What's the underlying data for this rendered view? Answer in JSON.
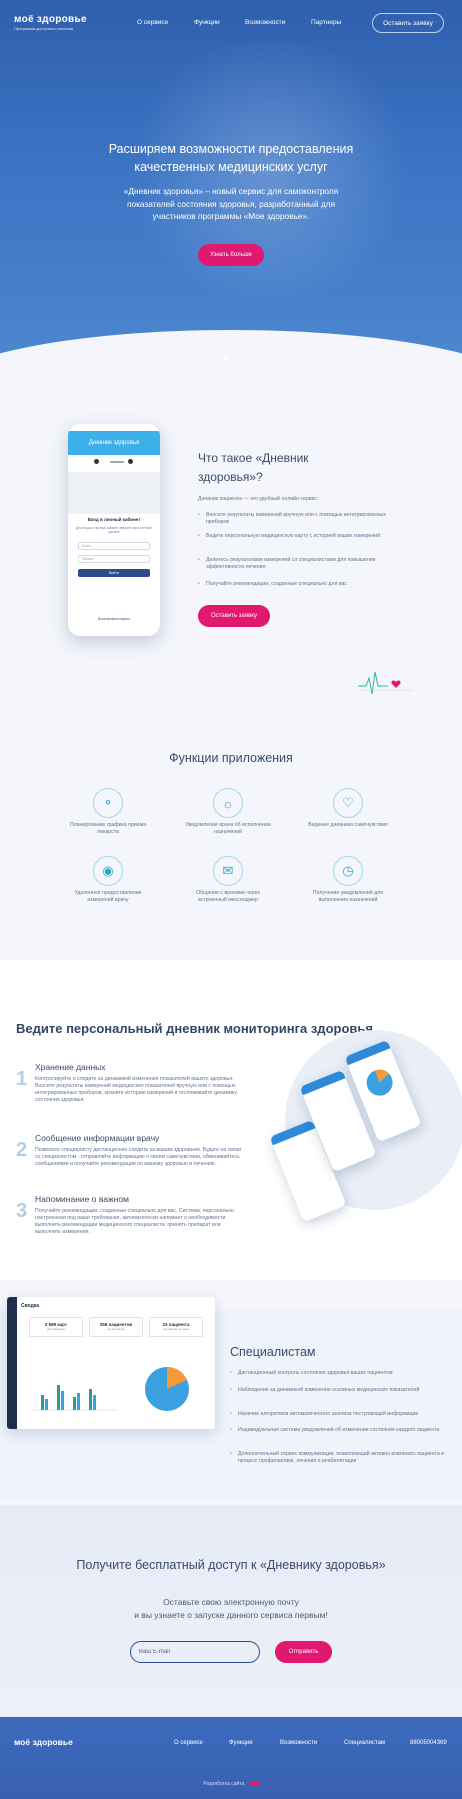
{
  "header": {
    "logo": "моё здоровье",
    "logo_sub": "Программа доступного лечения",
    "nav": [
      "О сервисе",
      "Функции",
      "Возможности",
      "Партнеры"
    ],
    "cta": "Оставить заявку"
  },
  "hero": {
    "title": "Расширяем возможности предоставления качественных медицинских услуг",
    "text": "«Дневник здоровья» – новый сервис для самоконтроля показателей состояния здоровья, разработанный для участников программы «Мое здоровье».",
    "button": "Узнать больше"
  },
  "phone": {
    "app_title": "Дневник здоровья",
    "login_title": "Вход в личный кабинет",
    "login_sub": "Для входа в личный кабинет введите свои учетные данные",
    "login_placeholder": "Логин",
    "password_placeholder": "Пароль",
    "login_button": "Войти",
    "forgot": "Восстановить пароль"
  },
  "about": {
    "title": "Что такое «Дневник здоровья»?",
    "intro": "Дневник пациента — это удобный онлайн сервис:",
    "items": [
      "Вносите результаты измерений вручную или с помощью интегрированных приборов",
      "Ведите персональную медицинскую карту с историей ваших измерений",
      "Делитесь результатами измерений со специалистами для повышения эффективности лечения",
      "Получайте рекомендации, созданные специально для вас"
    ],
    "button": "Оставить заявку"
  },
  "functions": {
    "title": "Функции приложения",
    "items": [
      {
        "label": "Планирование графика приема лекарств",
        "icon": "pill-icon"
      },
      {
        "label": "Уведомление врача об исполнении назначений",
        "icon": "bell-icon"
      },
      {
        "label": "Ведение дневника самочувствия",
        "icon": "heart-icon"
      },
      {
        "label": "Удаленное предоставление измерений врачу",
        "icon": "lock-icon"
      },
      {
        "label": "Общение с врачами через встроенный мессенджер",
        "icon": "message-icon"
      },
      {
        "label": "Получение уведомлений для выполнения назначений",
        "icon": "alarm-icon"
      }
    ]
  },
  "diary": {
    "title": "Ведите персональный дневник мониторинга здоровья",
    "items": [
      {
        "num": "1",
        "title": "Хранение данных",
        "text": "Контролируйте и следите за динамикой изменения показателей вашего здоровья. Вносите результаты измерений медицинских показателей вручную или с помощью интегрированных приборов, храните историю измерений и отслеживайте динамику состояния здоровья."
      },
      {
        "num": "2",
        "title": "Сообщение информации врачу",
        "text": "Позвольте специалисту дистанционно следить за вашим здоровьем. Будьте на связи со специалистом - отправляйте информацию о своем самочувствии, обменивайтесь сообщениями и получайте рекомендации по вашему здоровью и лечению."
      },
      {
        "num": "3",
        "title": "Напоминание о важном",
        "text": "Получайте рекомендации, созданные специально для вас. Система, персонально настроенная под ваши требования, автоматически напомнит о необходимости выполнить рекомендации медицинского специалиста: принять препарат или выполнить измерения."
      }
    ]
  },
  "dashboard": {
    "title": "Сводка",
    "stats": [
      {
        "value": "2 589 карт",
        "label": "для ведения"
      },
      {
        "value": "258 пациентов",
        "label": "на контроле"
      },
      {
        "value": "33 пациента",
        "label": "на приеме за день"
      }
    ]
  },
  "specialists": {
    "title": "Специалистам",
    "items": [
      "Дистанционный контроль состояния здоровья ваших пациентов",
      "Наблюдение за динамикой изменения основных медицинских показателей",
      "Наличие алгоритмов автоматического анализа поступающей информации",
      "Индивидуальная система уведомлений об изменении состояния каждого пациента",
      "Дополнительный сервис коммуникации, позволяющий активно вовлекать пациента в процесс профилактики, лечения и реабилитации"
    ]
  },
  "cta": {
    "title": "Получите бесплатный доступ к «Дневнику здоровья»",
    "text1": "Оставьте свою электронную почту",
    "text2": "и вы узнаете о запуске данного сервиса первым!",
    "placeholder": "Ваш E-mail",
    "button": "Отправить"
  },
  "footer": {
    "logo": "моё здоровье",
    "nav": [
      "О сервисе",
      "Функции",
      "Возможности",
      "Специалистам",
      "88005004369"
    ],
    "dev": "Разработка сайта"
  },
  "colors": {
    "accent": "#e0186f",
    "primary": "#3a6bbd",
    "text": "#3a4a6b"
  }
}
